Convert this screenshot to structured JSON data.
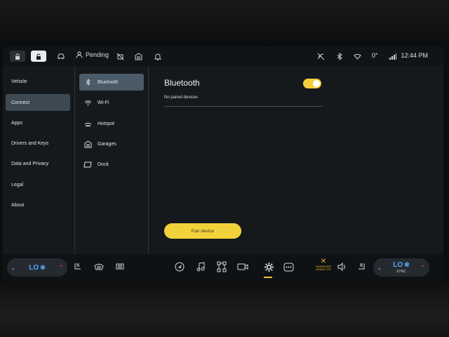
{
  "status_bar": {
    "pending_label": "Pending",
    "clock": "12:44 PM",
    "temperature": "0°",
    "icons": [
      "lock-icon",
      "unlock-icon",
      "car-icon",
      "person-icon",
      "no-camera-icon",
      "garage-icon",
      "bell-icon",
      "connectivity-icon",
      "bluetooth-icon",
      "wifi-icon",
      "signal-icon"
    ]
  },
  "nav_primary": {
    "items": [
      {
        "label": "Vehicle"
      },
      {
        "label": "Connect"
      },
      {
        "label": "Apps"
      },
      {
        "label": "Drivers and Keys"
      },
      {
        "label": "Data and Privacy"
      },
      {
        "label": "Legal"
      },
      {
        "label": "About"
      }
    ],
    "active": "Connect"
  },
  "nav_secondary": {
    "items": [
      {
        "label": "Bluetooth",
        "icon": "bluetooth-icon"
      },
      {
        "label": "Wi-Fi",
        "icon": "wifi-icon"
      },
      {
        "label": "Hotspot",
        "icon": "hotspot-icon"
      },
      {
        "label": "Garages",
        "icon": "garage-icon"
      },
      {
        "label": "Dock",
        "icon": "dock-icon"
      }
    ],
    "active": "Bluetooth"
  },
  "content": {
    "title": "Bluetooth",
    "toggle_on": true,
    "empty_text": "No paired devices",
    "pair_button_label": "Pair device"
  },
  "dock": {
    "climate_left": {
      "value": "LO"
    },
    "climate_right": {
      "value": "LO",
      "sync_label": "SYNC"
    },
    "airbag_text": "PASSENGER AIRBAG OFF",
    "accent_color": "#f2c63a",
    "climate_color": "#59a8ff",
    "arrow_color": "#e4463d"
  },
  "colors": {
    "screen_bg": "#15191c",
    "nav_active": "#3d4a54",
    "toggle": "#f2cf3a",
    "pair_button": "#f2d23a"
  }
}
